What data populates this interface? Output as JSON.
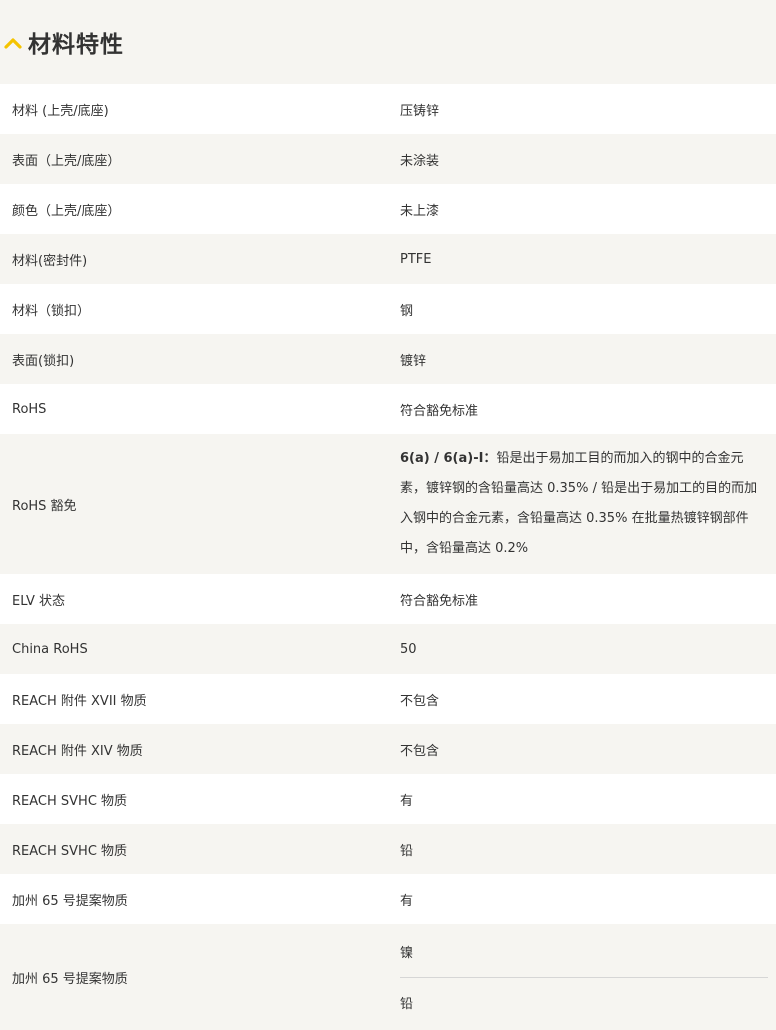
{
  "header": {
    "title": "材料特性",
    "accent_color": "#f5c400",
    "toggle_icon": "chevron-up-icon"
  },
  "rows": [
    {
      "label": "材料 (上壳/底座)",
      "value": "压铸锌"
    },
    {
      "label": "表面（上壳/底座）",
      "value": "未涂装"
    },
    {
      "label": "颜色（上壳/底座）",
      "value": "未上漆"
    },
    {
      "label": "材料(密封件)",
      "value": "PTFE"
    },
    {
      "label": "材料（锁扣）",
      "value": "钢"
    },
    {
      "label": "表面(锁扣)",
      "value": "镀锌"
    },
    {
      "label": "RoHS",
      "value": "符合豁免标准"
    },
    {
      "label": "RoHS 豁免",
      "value_strong": "6(a) / 6(a)-I：",
      "value": "铅是出于易加工目的而加入的钢中的合金元素，镀锌钢的含铅量高达 0.35% / 铅是出于易加工的目的而加入钢中的合金元素，含铅量高达 0.35% 在批量热镀锌钢部件中，含铅量高达 0.2%"
    },
    {
      "label": "ELV 状态",
      "value": "符合豁免标准"
    },
    {
      "label": "China RoHS",
      "value": "50"
    },
    {
      "label": "REACH 附件 XVII 物质",
      "value": "不包含"
    },
    {
      "label": "REACH 附件 XIV 物质",
      "value": "不包含"
    },
    {
      "label": "REACH SVHC 物质",
      "value": "有"
    },
    {
      "label": "REACH SVHC 物质",
      "value": "铅"
    },
    {
      "label": "加州 65 号提案物质",
      "value": "有"
    },
    {
      "label": "加州 65 号提案物质",
      "values": [
        "镍",
        "铅"
      ]
    }
  ]
}
